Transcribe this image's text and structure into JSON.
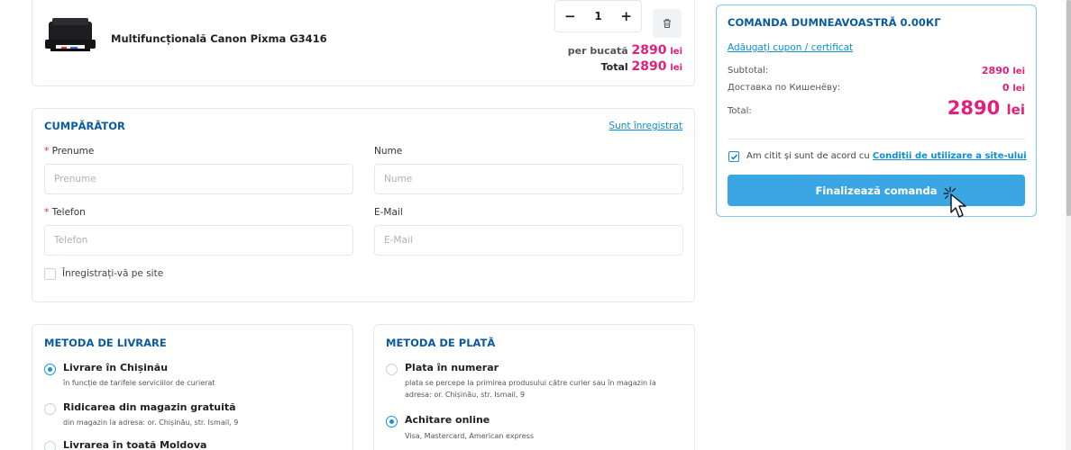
{
  "product": {
    "name": "Multifuncțională Canon Pixma G3416",
    "quantity": "1",
    "minus": "−",
    "plus": "+",
    "per_unit_label": "per bucată",
    "per_unit_value": "2890",
    "total_label": "Total",
    "total_value": "2890",
    "currency": "lei"
  },
  "buyer": {
    "title": "CUMPĂRĂTOR",
    "registered_link": "Sunt înregistrat",
    "first_name_label": "Prenume",
    "first_name_placeholder": "Prenume",
    "last_name_label": "Nume",
    "last_name_placeholder": "Nume",
    "phone_label": "Telefon",
    "phone_placeholder": "Telefon",
    "email_label": "E-Mail",
    "email_placeholder": "E-Mail",
    "register_label": "Înregistrați-vă pe site",
    "required_mark": "*"
  },
  "delivery": {
    "title": "METODA DE LIVRARE",
    "options": [
      {
        "title": "Livrare în Chișinău",
        "subtitle": "în funcție de tarifele serviciilor de curierat",
        "selected": true
      },
      {
        "title": "Ridicarea din magazin gratuită",
        "subtitle": "din magazin la adresa: or. Chișinău, str. Ismail, 9",
        "selected": false
      },
      {
        "title": "Livrarea în toată Moldova",
        "subtitle": "",
        "selected": false
      }
    ]
  },
  "payment": {
    "title": "METODA DE PLATĂ",
    "options": [
      {
        "title": "Plata în numerar",
        "subtitle": "plata se percepe la primirea produsului către curier sau în magazin la adresa: or. Chișinău, str. Ismail, 9",
        "selected": false
      },
      {
        "title": "Achitare online",
        "subtitle": "Visa, Mastercard, American express",
        "selected": true
      }
    ]
  },
  "summary": {
    "title": "COMANDA DUMNEAVOASTRĂ 0.00КГ",
    "coupon_link": "Adăugați cupon / certificat",
    "subtotal_label": "Subtotal:",
    "subtotal_value": "2890",
    "delivery_label": "Доставка по Кишенёву:",
    "delivery_value": "0",
    "total_label": "Total:",
    "total_value": "2890",
    "currency": "lei",
    "agree_text": "Am citit și sunt de acord cu",
    "agree_link": "Condiții de utilizare a site-ului",
    "finalize_label": "Finalizează comanda"
  },
  "colors": {
    "accent": "#3ba6e4",
    "price": "#e0207a",
    "heading": "#0b5a9e"
  }
}
